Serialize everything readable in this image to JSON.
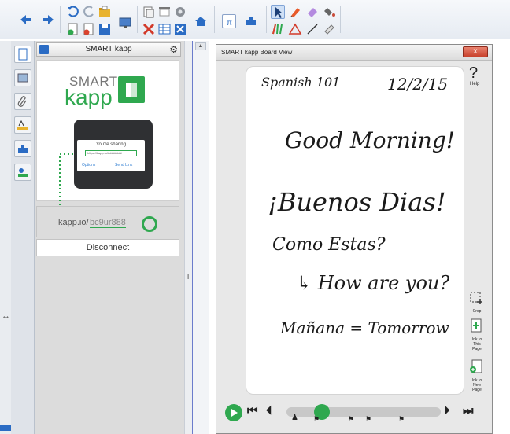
{
  "panel": {
    "title": "SMART kapp",
    "brand_top": "SMART",
    "brand_bottom": "kapp",
    "sharing_text": "You're sharing",
    "sharing_url": "https://kapp.io/########",
    "options_label": "Options",
    "send_link_label": "Send Link",
    "kapp_url_prefix": "kapp.io/",
    "kapp_code": "bc9ur888",
    "disconnect_label": "Disconnect"
  },
  "board": {
    "window_title": "SMART kapp Board View",
    "close_label": "x",
    "help_symbol": "?",
    "help_label": "Help",
    "crop_label": "Crop",
    "ink_this_page_label": "Ink to This Page",
    "ink_new_page_label": "Ink to New Page"
  },
  "handwriting": {
    "line1_left": "Spanish 101",
    "line1_right": "12/2/15",
    "line2": "Good Morning!",
    "line3": "¡Buenos Dias!",
    "line4": "Como Estas?",
    "line5": "↳ How are you?",
    "line6": "Mañana = Tomorrow"
  },
  "player": {
    "progress": 0.2
  },
  "colors": {
    "accent": "#2fa84f",
    "toolbar_blue": "#2b6cc4"
  }
}
